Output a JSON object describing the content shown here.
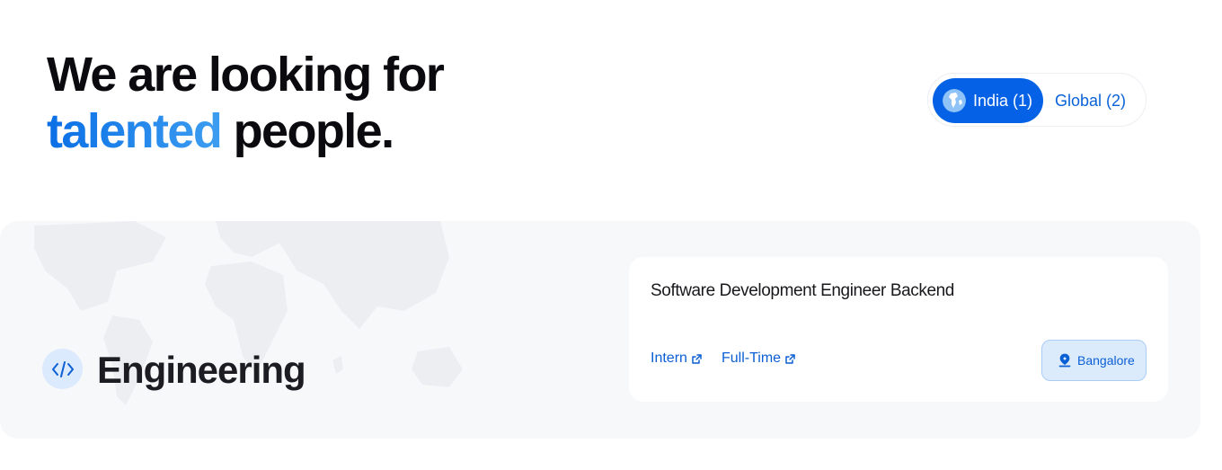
{
  "hero": {
    "line1": "We are looking for",
    "highlight": "talented",
    "rest": "people."
  },
  "region_toggle": {
    "india_label": "India (1)",
    "global_label": "Global (2)",
    "selected": "India (1)"
  },
  "department": {
    "title": "Engineering",
    "icon": "code-icon"
  },
  "job": {
    "title": "Software Development Engineer Backend",
    "types": [
      "Intern",
      "Full-Time"
    ],
    "location": "Bangalore"
  },
  "colors": {
    "accent": "#0562e6",
    "link": "#0b5fd4",
    "panel_bg": "#f7f8fa",
    "location_bg": "#dcebfc"
  }
}
